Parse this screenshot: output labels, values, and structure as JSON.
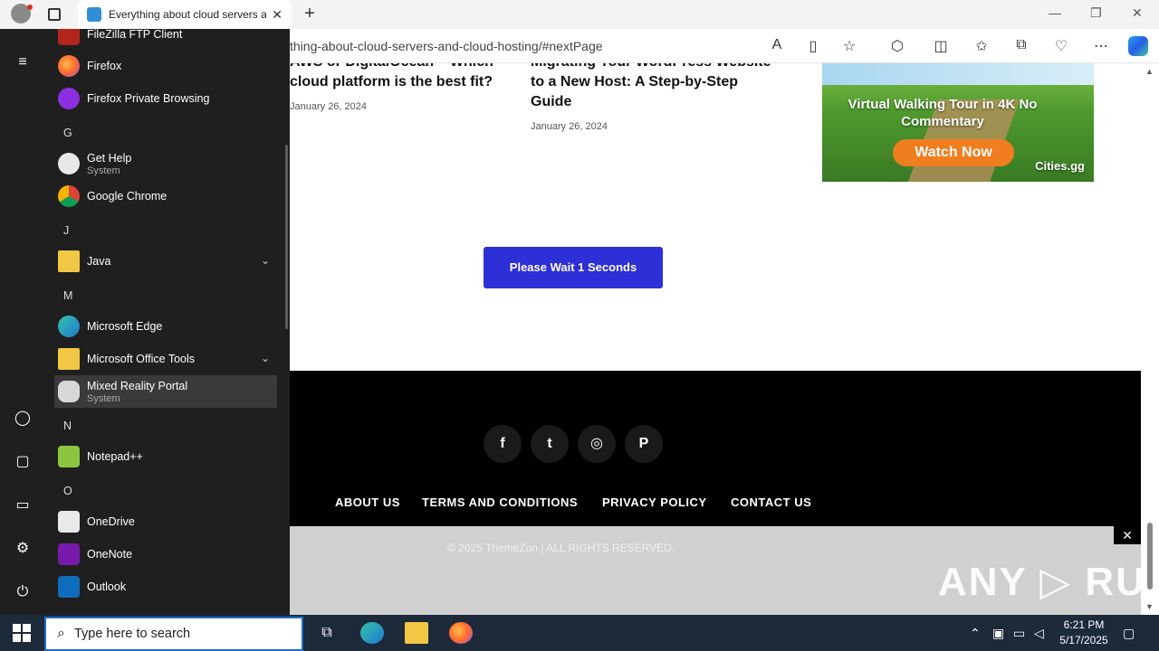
{
  "browser": {
    "tab_title": "Everything about cloud servers and cloud hosting",
    "new_tab": "+",
    "url_visible": "thing-about-cloud-servers-and-cloud-hosting/#nextPage",
    "window_controls": [
      "—",
      "❐",
      "✕"
    ]
  },
  "page": {
    "card1": {
      "title": "AWS or DigitalOcean – Which cloud platform is the best fit?",
      "date": "January 26, 2024"
    },
    "card2": {
      "title": "Migrating Your WordPress Website to a New Host: A Step-by-Step Guide",
      "date": "January 26, 2024"
    },
    "ad": {
      "headline": "Virtual Walking Tour in 4K No Commentary",
      "button": "Watch Now",
      "brand": "Cities.gg"
    },
    "wait_button": "Please Wait 1 Seconds",
    "social": [
      {
        "name": "facebook",
        "glyph": "f"
      },
      {
        "name": "twitter",
        "glyph": "t"
      },
      {
        "name": "instagram",
        "glyph": "◎"
      },
      {
        "name": "pinterest",
        "glyph": "P"
      }
    ],
    "footer_nav": [
      "ABOUT US",
      "TERMS AND CONDITIONS",
      "PRIVACY POLICY",
      "CONTACT US"
    ],
    "copyright": "© 2025 ThemeZon | ALL RIGHTS RESERVED.",
    "close_ad": "✕",
    "watermark": "ANY ▷ RUN"
  },
  "start_menu": {
    "letters": {
      "G": "G",
      "J": "J",
      "M": "M",
      "N": "N",
      "O": "O"
    },
    "apps": {
      "filezilla": {
        "name": "FileZilla FTP Client"
      },
      "firefox": {
        "name": "Firefox"
      },
      "firefox_private": {
        "name": "Firefox Private Browsing"
      },
      "get_help": {
        "name": "Get Help",
        "sub": "System"
      },
      "chrome": {
        "name": "Google Chrome"
      },
      "java": {
        "name": "Java"
      },
      "edge": {
        "name": "Microsoft Edge"
      },
      "office_tools": {
        "name": "Microsoft Office Tools"
      },
      "mixed_reality": {
        "name": "Mixed Reality Portal",
        "sub": "System"
      },
      "notepadpp": {
        "name": "Notepad++"
      },
      "onedrive": {
        "name": "OneDrive"
      },
      "onenote": {
        "name": "OneNote"
      },
      "outlook": {
        "name": "Outlook"
      }
    }
  },
  "taskbar": {
    "search_placeholder": "Type here to search",
    "time": "6:21 PM",
    "date": "5/17/2025"
  },
  "colors": {
    "accent_blue": "#2d2fd7",
    "start_bg": "#1f1f1f",
    "taskbar_bg": "#1c2a3a",
    "footer_bg": "#000000"
  }
}
